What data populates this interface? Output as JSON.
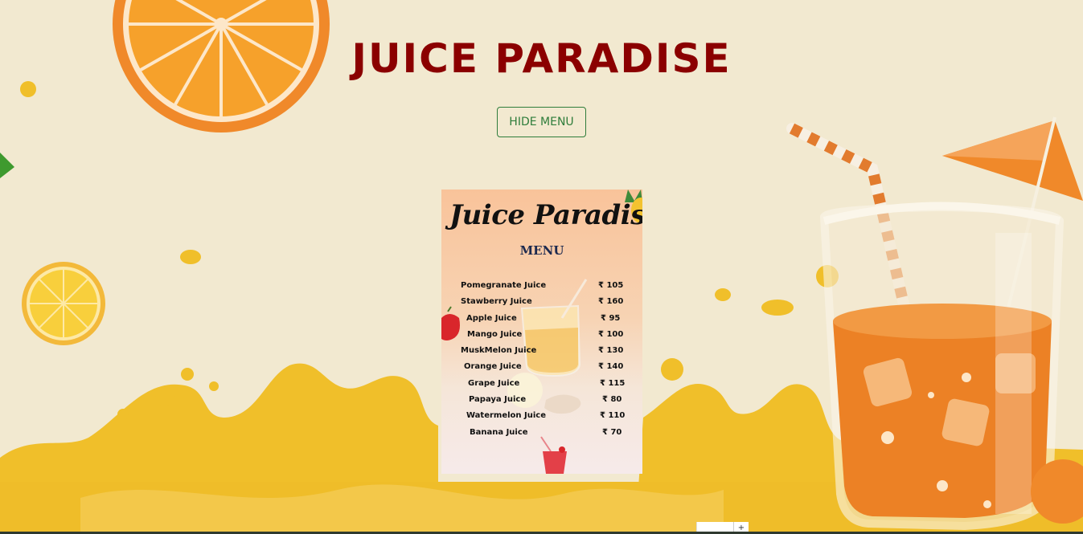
{
  "page": {
    "title": "JUICE PARADISE",
    "toggle_button_label": "HIDE MENU"
  },
  "menu_card": {
    "script_title": "Juice Paradise",
    "heading": "MENU",
    "items": [
      {
        "name": "Pomegranate Juice",
        "price": "₹ 105"
      },
      {
        "name": "Stawberry  Juice",
        "price": "₹ 160"
      },
      {
        "name": "Apple  Juice",
        "price": "₹ 95"
      },
      {
        "name": "Mango Juice",
        "price": "₹ 100"
      },
      {
        "name": "MuskMelon  Juice",
        "price": "₹ 130"
      },
      {
        "name": "Orange  Juice",
        "price": "₹ 140"
      },
      {
        "name": "Grape  Juice",
        "price": "₹ 115"
      },
      {
        "name": "Papaya Juice",
        "price": "₹ 80"
      },
      {
        "name": "Watermelon Juice",
        "price": "₹ 110"
      },
      {
        "name": "Banana Juice",
        "price": "₹ 70"
      }
    ]
  },
  "zoom_control": {
    "plus_label": "+"
  },
  "colors": {
    "background": "#f2e9d0",
    "title": "#8b0000",
    "button_border": "#2f7d3b",
    "splash": "#f0bf2a",
    "orange": "#f0892a"
  },
  "icons": [
    "orange-slice-icon",
    "lemon-slice-icon",
    "juice-glass-icon",
    "umbrella-icon",
    "straw-icon",
    "apple-icon",
    "pineapple-icon",
    "plus-icon"
  ]
}
